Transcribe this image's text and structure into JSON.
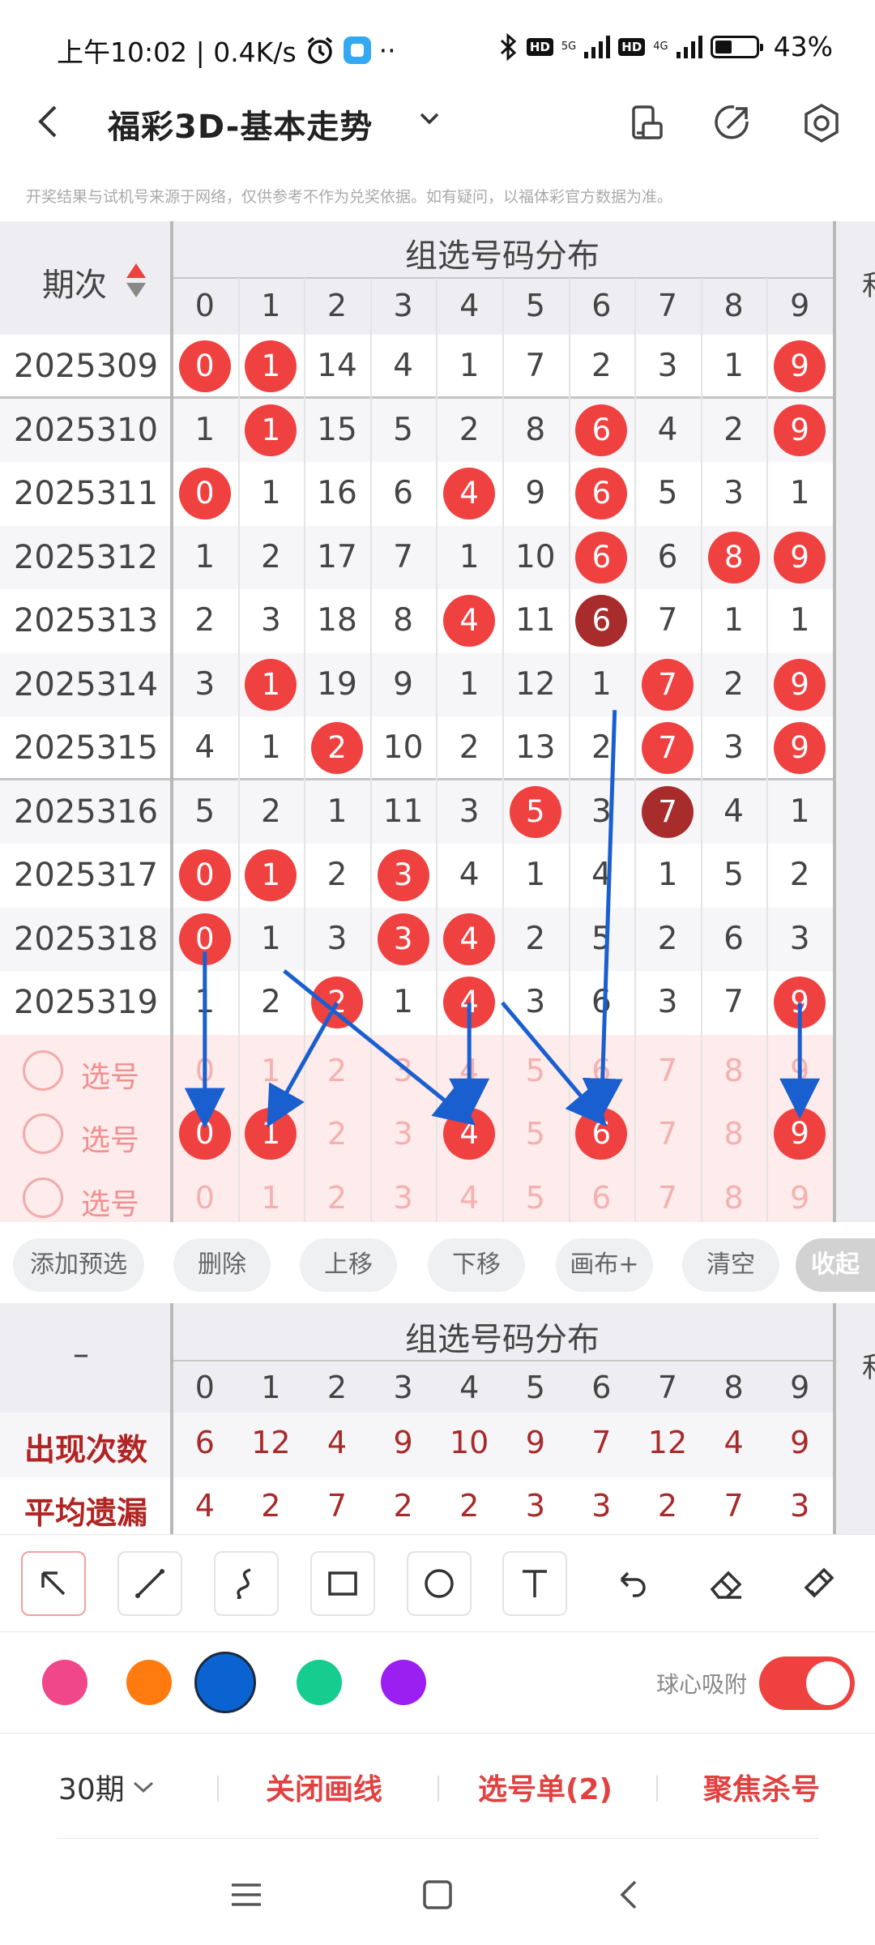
{
  "status": {
    "time": "上午10:02 | 0.4K/s",
    "more": "··",
    "hd1": "HD",
    "sig1": "5G",
    "hd2": "HD",
    "sig2": "4G",
    "battery_level": 0.43,
    "battery": "43%"
  },
  "header": {
    "back": "<",
    "title": "福彩3D-基本走势",
    "icons": [
      "device-icon",
      "share-icon",
      "settings-icon"
    ]
  },
  "notice": "开奖结果与试机号来源于网络，仅供参考不作为兑奖依据。如有疑问，以福体彩官方数据为准。",
  "grid": {
    "period_header": "期次",
    "section_title": "组选号码分布",
    "right_cut_label": "和",
    "digits": [
      "0",
      "1",
      "2",
      "3",
      "4",
      "5",
      "6",
      "7",
      "8",
      "9"
    ],
    "rows": [
      {
        "period": "2025309",
        "cells": [
          "0",
          "1",
          "14",
          "4",
          "1",
          "7",
          "2",
          "3",
          "1",
          "9"
        ],
        "hits": [
          0,
          1,
          9
        ],
        "dark": []
      },
      {
        "period": "2025310",
        "cells": [
          "1",
          "1",
          "15",
          "5",
          "2",
          "8",
          "6",
          "4",
          "2",
          "9"
        ],
        "hits": [
          1,
          6,
          9
        ],
        "dark": []
      },
      {
        "period": "2025311",
        "cells": [
          "0",
          "1",
          "16",
          "6",
          "4",
          "9",
          "6",
          "5",
          "3",
          "1"
        ],
        "hits": [
          0,
          4,
          6
        ],
        "dark": []
      },
      {
        "period": "2025312",
        "cells": [
          "1",
          "2",
          "17",
          "7",
          "1",
          "10",
          "6",
          "6",
          "8",
          "9"
        ],
        "hits": [
          6,
          8,
          9
        ],
        "dark": []
      },
      {
        "period": "2025313",
        "cells": [
          "2",
          "3",
          "18",
          "8",
          "4",
          "11",
          "6",
          "7",
          "1",
          "1"
        ],
        "hits": [
          4,
          6
        ],
        "dark": [
          6
        ]
      },
      {
        "period": "2025314",
        "cells": [
          "3",
          "1",
          "19",
          "9",
          "1",
          "12",
          "1",
          "7",
          "2",
          "9"
        ],
        "hits": [
          1,
          7,
          9
        ],
        "dark": []
      },
      {
        "period": "2025315",
        "cells": [
          "4",
          "1",
          "2",
          "10",
          "2",
          "13",
          "2",
          "7",
          "3",
          "9"
        ],
        "hits": [
          2,
          7,
          9
        ],
        "dark": []
      },
      {
        "period": "2025316",
        "cells": [
          "5",
          "2",
          "1",
          "11",
          "3",
          "5",
          "3",
          "7",
          "4",
          "1"
        ],
        "hits": [
          5,
          7
        ],
        "dark": [
          7
        ]
      },
      {
        "period": "2025317",
        "cells": [
          "0",
          "1",
          "2",
          "3",
          "4",
          "1",
          "4",
          "1",
          "5",
          "2"
        ],
        "hits": [
          0,
          1,
          3
        ],
        "dark": []
      },
      {
        "period": "2025318",
        "cells": [
          "0",
          "1",
          "3",
          "3",
          "4",
          "2",
          "5",
          "2",
          "6",
          "3"
        ],
        "hits": [
          0,
          3,
          4
        ],
        "dark": []
      },
      {
        "period": "2025319",
        "cells": [
          "1",
          "2",
          "2",
          "1",
          "4",
          "3",
          "6",
          "3",
          "7",
          "9"
        ],
        "hits": [
          2,
          4,
          9
        ],
        "dark": []
      }
    ],
    "select_label": "选号",
    "select_rows": [
      {
        "hits": []
      },
      {
        "hits": [
          0,
          1,
          4,
          6,
          9
        ]
      },
      {
        "hits": []
      }
    ]
  },
  "toolbar": {
    "buttons": [
      "添加预选",
      "删除",
      "上移",
      "下移",
      "画布+",
      "清空"
    ],
    "collapse": "收起"
  },
  "stats": {
    "dash": "–",
    "section_title": "组选号码分布",
    "right_cut_label": "和",
    "digits": [
      "0",
      "1",
      "2",
      "3",
      "4",
      "5",
      "6",
      "7",
      "8",
      "9"
    ],
    "rows": [
      {
        "label": "出现次数",
        "values": [
          "6",
          "12",
          "4",
          "9",
          "10",
          "9",
          "7",
          "12",
          "4",
          "9"
        ]
      },
      {
        "label": "平均遗漏",
        "values": [
          "4",
          "2",
          "7",
          "2",
          "2",
          "3",
          "3",
          "2",
          "7",
          "3"
        ]
      }
    ]
  },
  "draw_tools": [
    "pointer-tool-icon",
    "line-tool-icon",
    "curve-tool-icon",
    "rectangle-tool-icon",
    "circle-tool-icon",
    "text-tool-icon",
    "undo-icon",
    "eraser-icon",
    "clear-drawing-icon"
  ],
  "colors": {
    "palette": [
      "#f0478a",
      "#ff7a0f",
      "#0a63d1",
      "#16cc8f",
      "#9b1ff0"
    ],
    "selected": 2,
    "hit": "#f04141",
    "hit_dark": "#a82c2c",
    "arrow": "#1a5fcf",
    "accent": "#e24141"
  },
  "snap_label": "球心吸附",
  "snap_on": true,
  "bottom": {
    "periods": "30期",
    "close_lines": "关闭画线",
    "selection_list": "选号单(2)",
    "focus_kill": "聚焦杀号"
  },
  "nav": [
    "menu-icon",
    "home-icon",
    "back-icon"
  ]
}
